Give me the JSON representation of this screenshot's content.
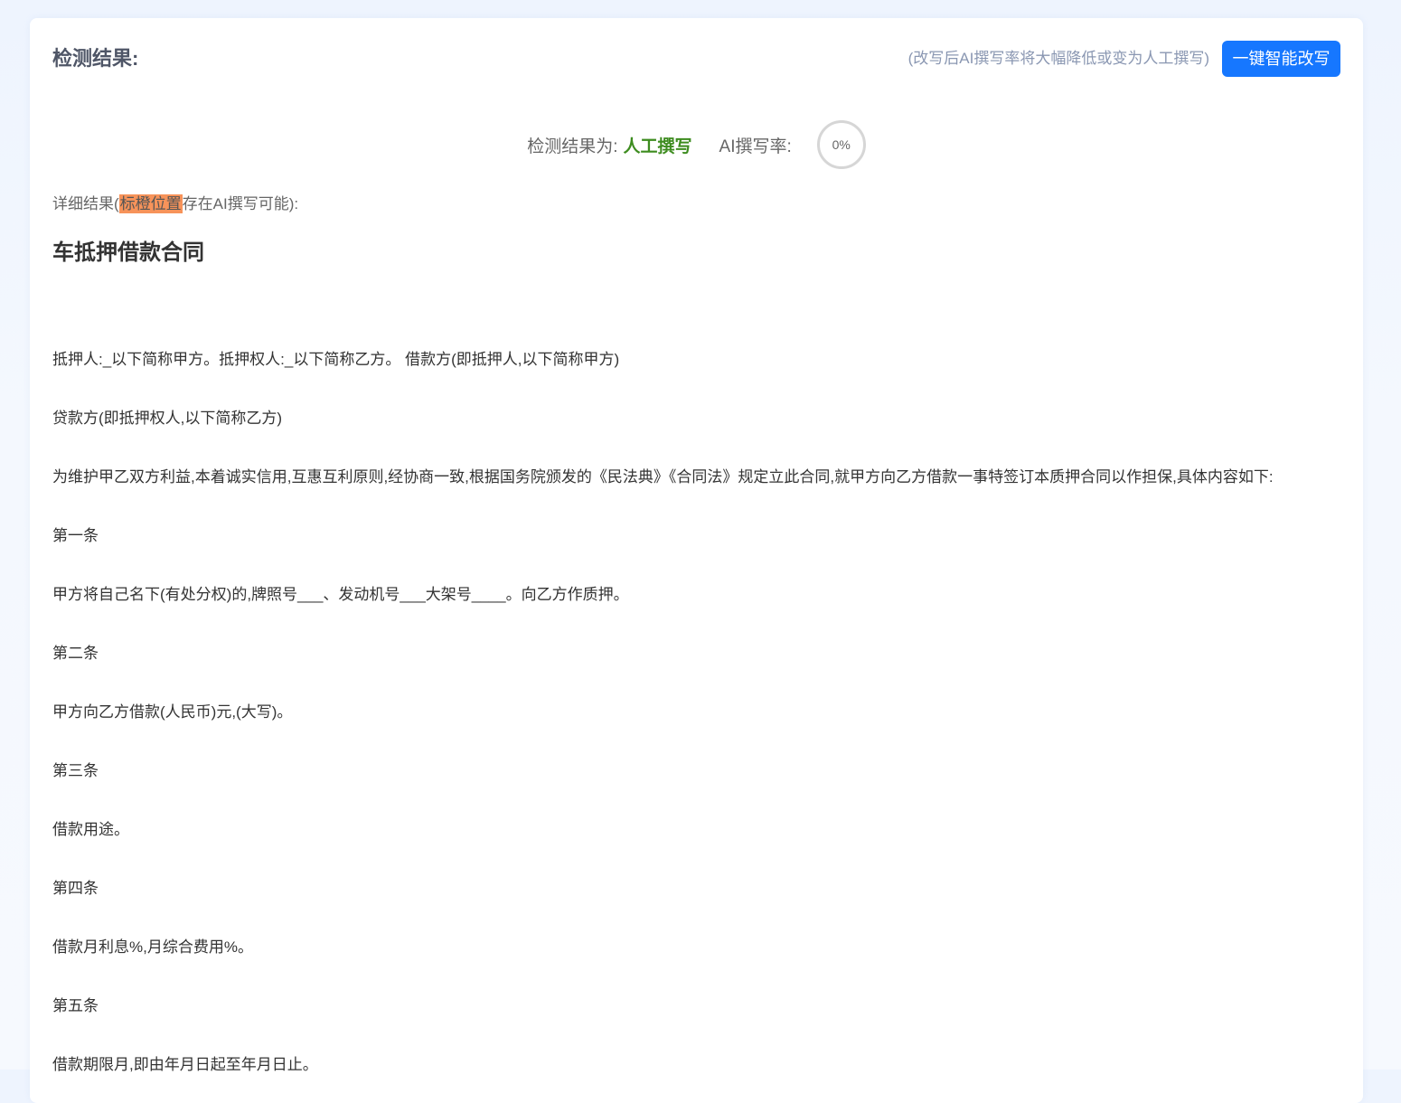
{
  "header": {
    "title": "检测结果:",
    "hint": "(改写后AI撰写率将大幅降低或变为人工撰写)",
    "rewrite_button": "一键智能改写"
  },
  "result": {
    "label": "检测结果为:",
    "value": "人工撰写",
    "ai_rate_label": "AI撰写率:",
    "ai_rate": "0%"
  },
  "detail": {
    "prefix": "详细结果(",
    "highlight": "标橙位置",
    "suffix": "存在AI撰写可能):"
  },
  "document": {
    "title": "车抵押借款合同",
    "paragraphs": [
      "抵押人:_以下简称甲方。抵押权人:_以下简称乙方。 借款方(即抵押人,以下简称甲方)",
      "贷款方(即抵押权人,以下简称乙方)",
      "为维护甲乙双方利益,本着诚实信用,互惠互利原则,经协商一致,根据国务院颁发的《民法典》《合同法》规定立此合同,就甲方向乙方借款一事特签订本质押合同以作担保,具体内容如下:",
      "第一条",
      "甲方将自己名下(有处分权)的,牌照号___、发动机号___大架号____。向乙方作质押。",
      "第二条",
      "甲方向乙方借款(人民币)元,(大写)。",
      "第三条",
      "借款用途。",
      "第四条",
      "借款月利息%,月综合费用%。",
      "第五条",
      "借款期限月,即由年月日起至年月日止。"
    ]
  }
}
